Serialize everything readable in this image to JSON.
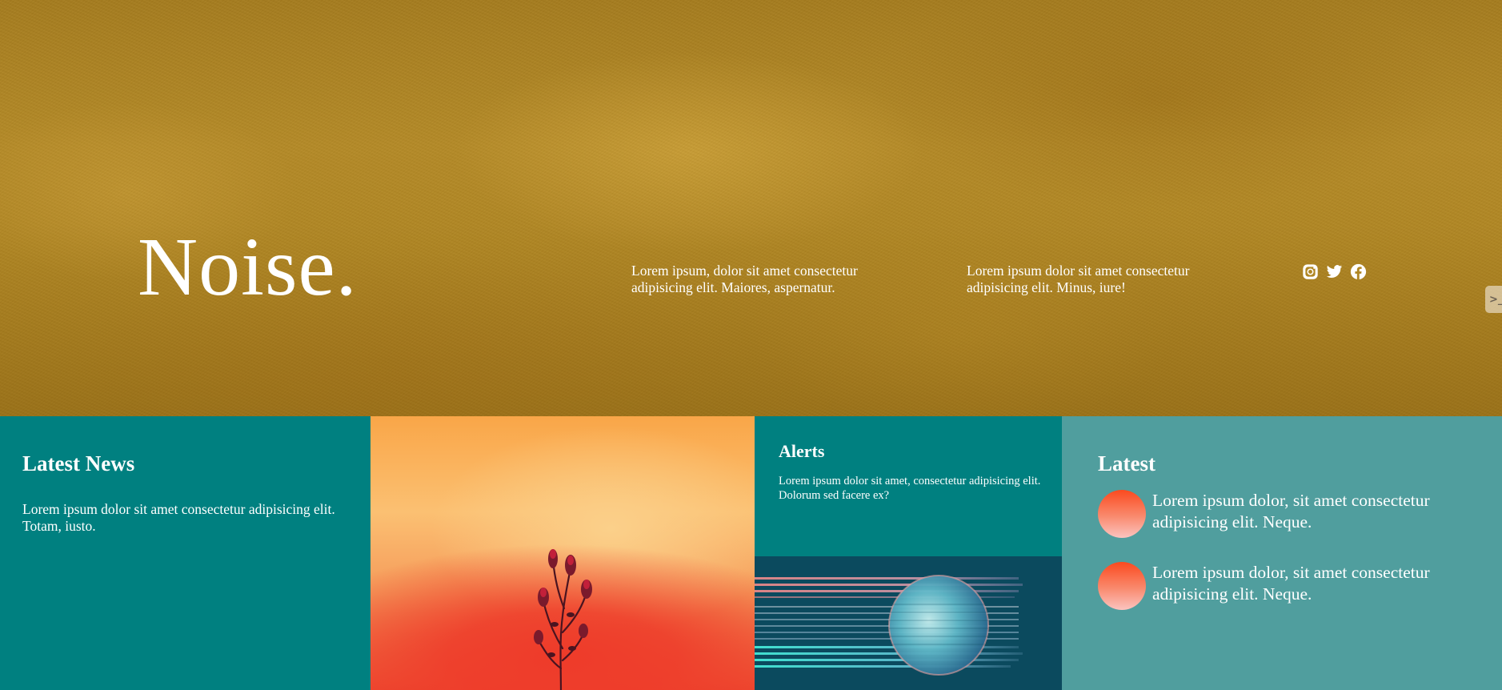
{
  "hero": {
    "logo": "Noise.",
    "text_1": "Lorem ipsum, dolor sit amet consectetur adipisicing elit. Maiores, aspernatur.",
    "text_2": "Lorem ipsum dolor sit amet consectetur adipisicing elit. Minus, iure!",
    "socials": [
      {
        "name": "instagram-icon"
      },
      {
        "name": "twitter-icon"
      },
      {
        "name": "facebook-icon"
      }
    ],
    "side_tab_glyph": ">_"
  },
  "news": {
    "title": "Latest News",
    "text": "Lorem ipsum dolor sit amet consectetur adipisicing elit. Totam, iusto."
  },
  "alerts": {
    "title": "Alerts",
    "text": "Lorem ipsum dolor sit amet, consectetur adipisicing elit. Dolorum sed facere ex?"
  },
  "latest": {
    "title": "Latest",
    "items": [
      {
        "text": "Lorem ipsum dolor, sit amet consectetur adipisicing elit. Neque."
      },
      {
        "text": "Lorem ipsum dolor, sit amet consectetur adipisicing elit. Neque."
      }
    ]
  },
  "colors": {
    "teal": "#008080",
    "teal_light": "#509e9e",
    "hero_mustard": "#b08623"
  }
}
